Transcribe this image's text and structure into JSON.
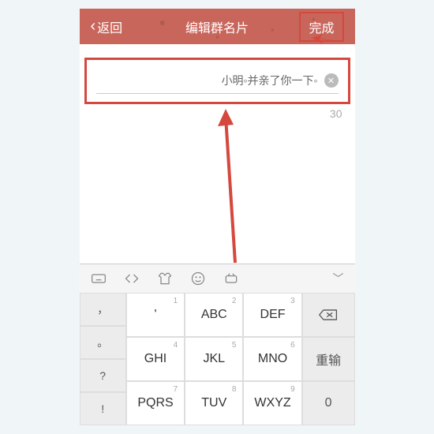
{
  "header": {
    "back": "返回",
    "title": "编辑群名片",
    "done": "完成"
  },
  "input": {
    "value": "小明◦并亲了你一下◦",
    "counter": "30"
  },
  "keyboard": {
    "rows": [
      [
        "，",
        "'",
        "ABC",
        "DEF",
        "⌫"
      ],
      [
        "。",
        "GHI",
        "JKL",
        "MNO",
        "重输"
      ],
      [
        "?",
        "",
        "",
        "",
        ""
      ],
      [
        "!",
        "PQRS",
        "TUV",
        "WXYZ",
        "0"
      ]
    ],
    "sup": {
      "0-1": "1",
      "0-2": "2",
      "0-3": "3",
      "1-1": "4",
      "1-2": "5",
      "1-3": "6",
      "3-1": "7",
      "3-2": "8",
      "3-3": "9"
    }
  }
}
